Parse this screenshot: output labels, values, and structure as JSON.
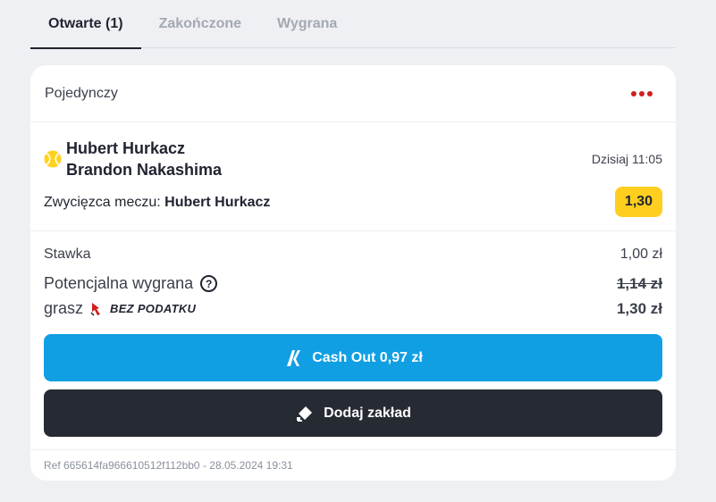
{
  "tabs": [
    {
      "label": "Otwarte (1)",
      "active": true
    },
    {
      "label": "Zakończone",
      "active": false
    },
    {
      "label": "Wygrana",
      "active": false
    }
  ],
  "card": {
    "type": "Pojedynczy",
    "menu_icon": "more-dots-icon",
    "event": {
      "sport_icon": "tennis-ball-icon",
      "player1": "Hubert Hurkacz",
      "player2": "Brandon Nakashima",
      "time": "Dzisiaj 11:05",
      "market": "Zwycięzca meczu:",
      "pick": "Hubert Hurkacz",
      "odds": "1,30"
    },
    "stake_label": "Stawka",
    "stake_value": "1,00 zł",
    "potential_label": "Potencjalna wygrana",
    "potential_old": "1,14 zł",
    "tax_label": "grasz",
    "tax_badge": "BEZ PODATKU",
    "potential_new": "1,30 zł",
    "cashout_label": "Cash Out 0,97 zł",
    "add_bet_label": "Dodaj zakład",
    "ref": "Ref 665614fa966610512f112bb0 - 28.05.2024 19:31"
  },
  "colors": {
    "accent_red": "#d01e1e",
    "odds_yellow": "#ffce1f",
    "cashout_blue": "#119fe3",
    "dark_button": "#262a33"
  }
}
